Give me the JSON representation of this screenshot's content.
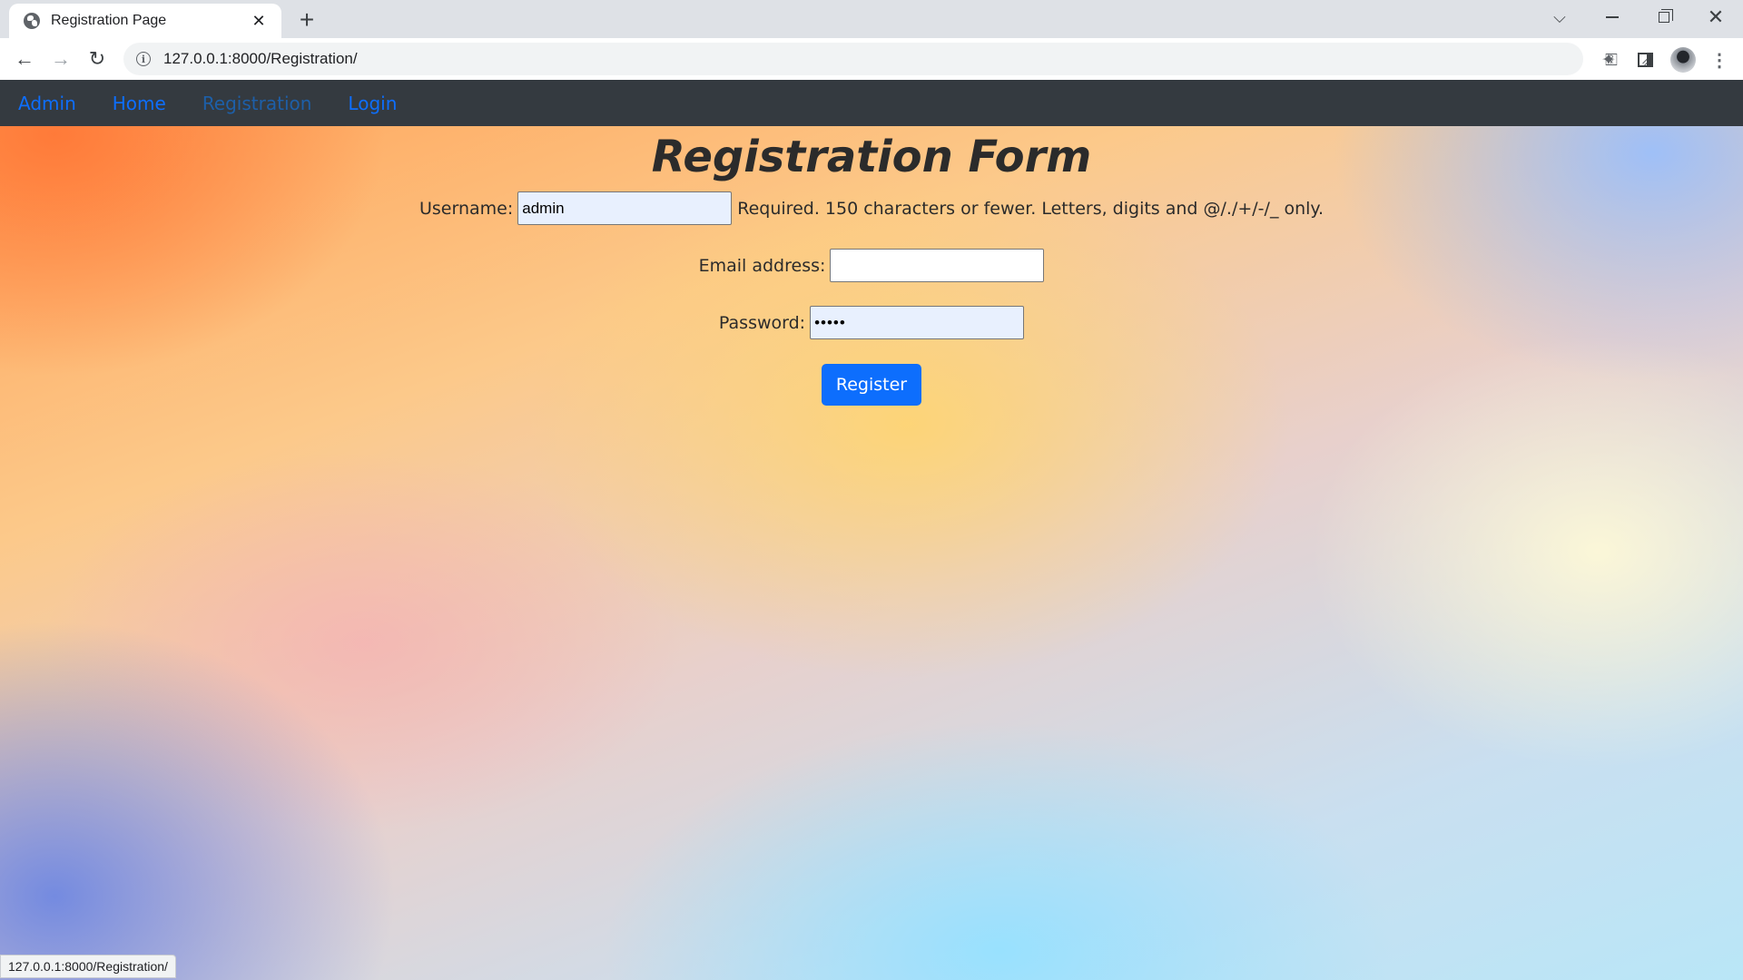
{
  "browser": {
    "tab": {
      "title": "Registration Page",
      "close": "✕"
    },
    "new_tab": "+",
    "window": {
      "dropdown": "⌵",
      "close": "✕"
    },
    "nav": {
      "back": "←",
      "forward": "→",
      "reload": "↻"
    },
    "address": {
      "info": "i",
      "url": "127.0.0.1:8000/Registration/"
    },
    "icons": {
      "key": "⚿",
      "share": "⇗",
      "star": "☆",
      "extensions": "✦",
      "menu": "⋮"
    },
    "status_url": "127.0.0.1:8000/Registration/"
  },
  "site_nav": {
    "items": [
      {
        "label": "Admin",
        "active": false
      },
      {
        "label": "Home",
        "active": false
      },
      {
        "label": "Registration",
        "active": true
      },
      {
        "label": "Login",
        "active": false
      }
    ]
  },
  "form": {
    "title": "Registration Form",
    "username": {
      "label": "Username:",
      "value": "admin",
      "help": "Required. 150 characters or fewer. Letters, digits and @/./+/-/_ only."
    },
    "email": {
      "label": "Email address:",
      "value": ""
    },
    "password": {
      "label": "Password:",
      "value": "•••••"
    },
    "submit": "Register"
  },
  "colors": {
    "nav_bg": "#343a40",
    "link": "#0d6efd",
    "button": "#0d6efd"
  }
}
